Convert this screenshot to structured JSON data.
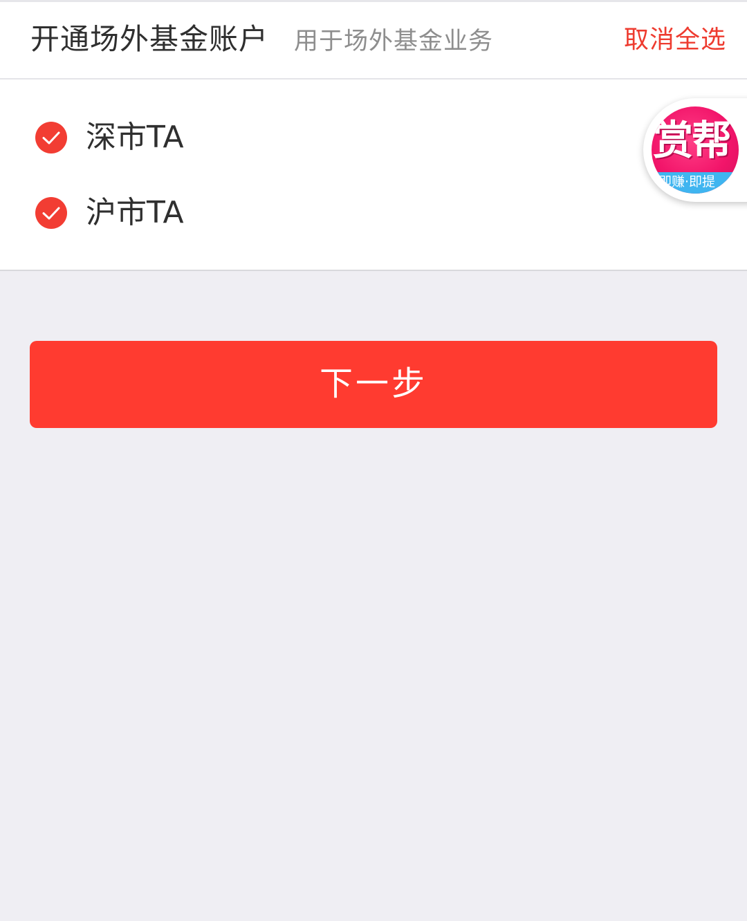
{
  "header": {
    "title": "开通场外基金账户",
    "subtitle": "用于场外基金业务",
    "cancel_all_label": "取消全选"
  },
  "options": [
    {
      "label": "深市TA",
      "checked": true,
      "icon": "checked-circle-icon"
    },
    {
      "label": "沪市TA",
      "checked": true,
      "icon": "checked-circle-icon"
    }
  ],
  "floating_badge": {
    "main_text": "赏帮",
    "sub_text": "即赚·即提"
  },
  "next_button": {
    "label": "下一步"
  },
  "colors": {
    "accent": "#ff3b30",
    "check": "#f23d33",
    "cancel_text": "#ee3b2f",
    "background": "#efeef3",
    "badge_pink": "#f2156a",
    "badge_blue": "#3fb5f0"
  }
}
